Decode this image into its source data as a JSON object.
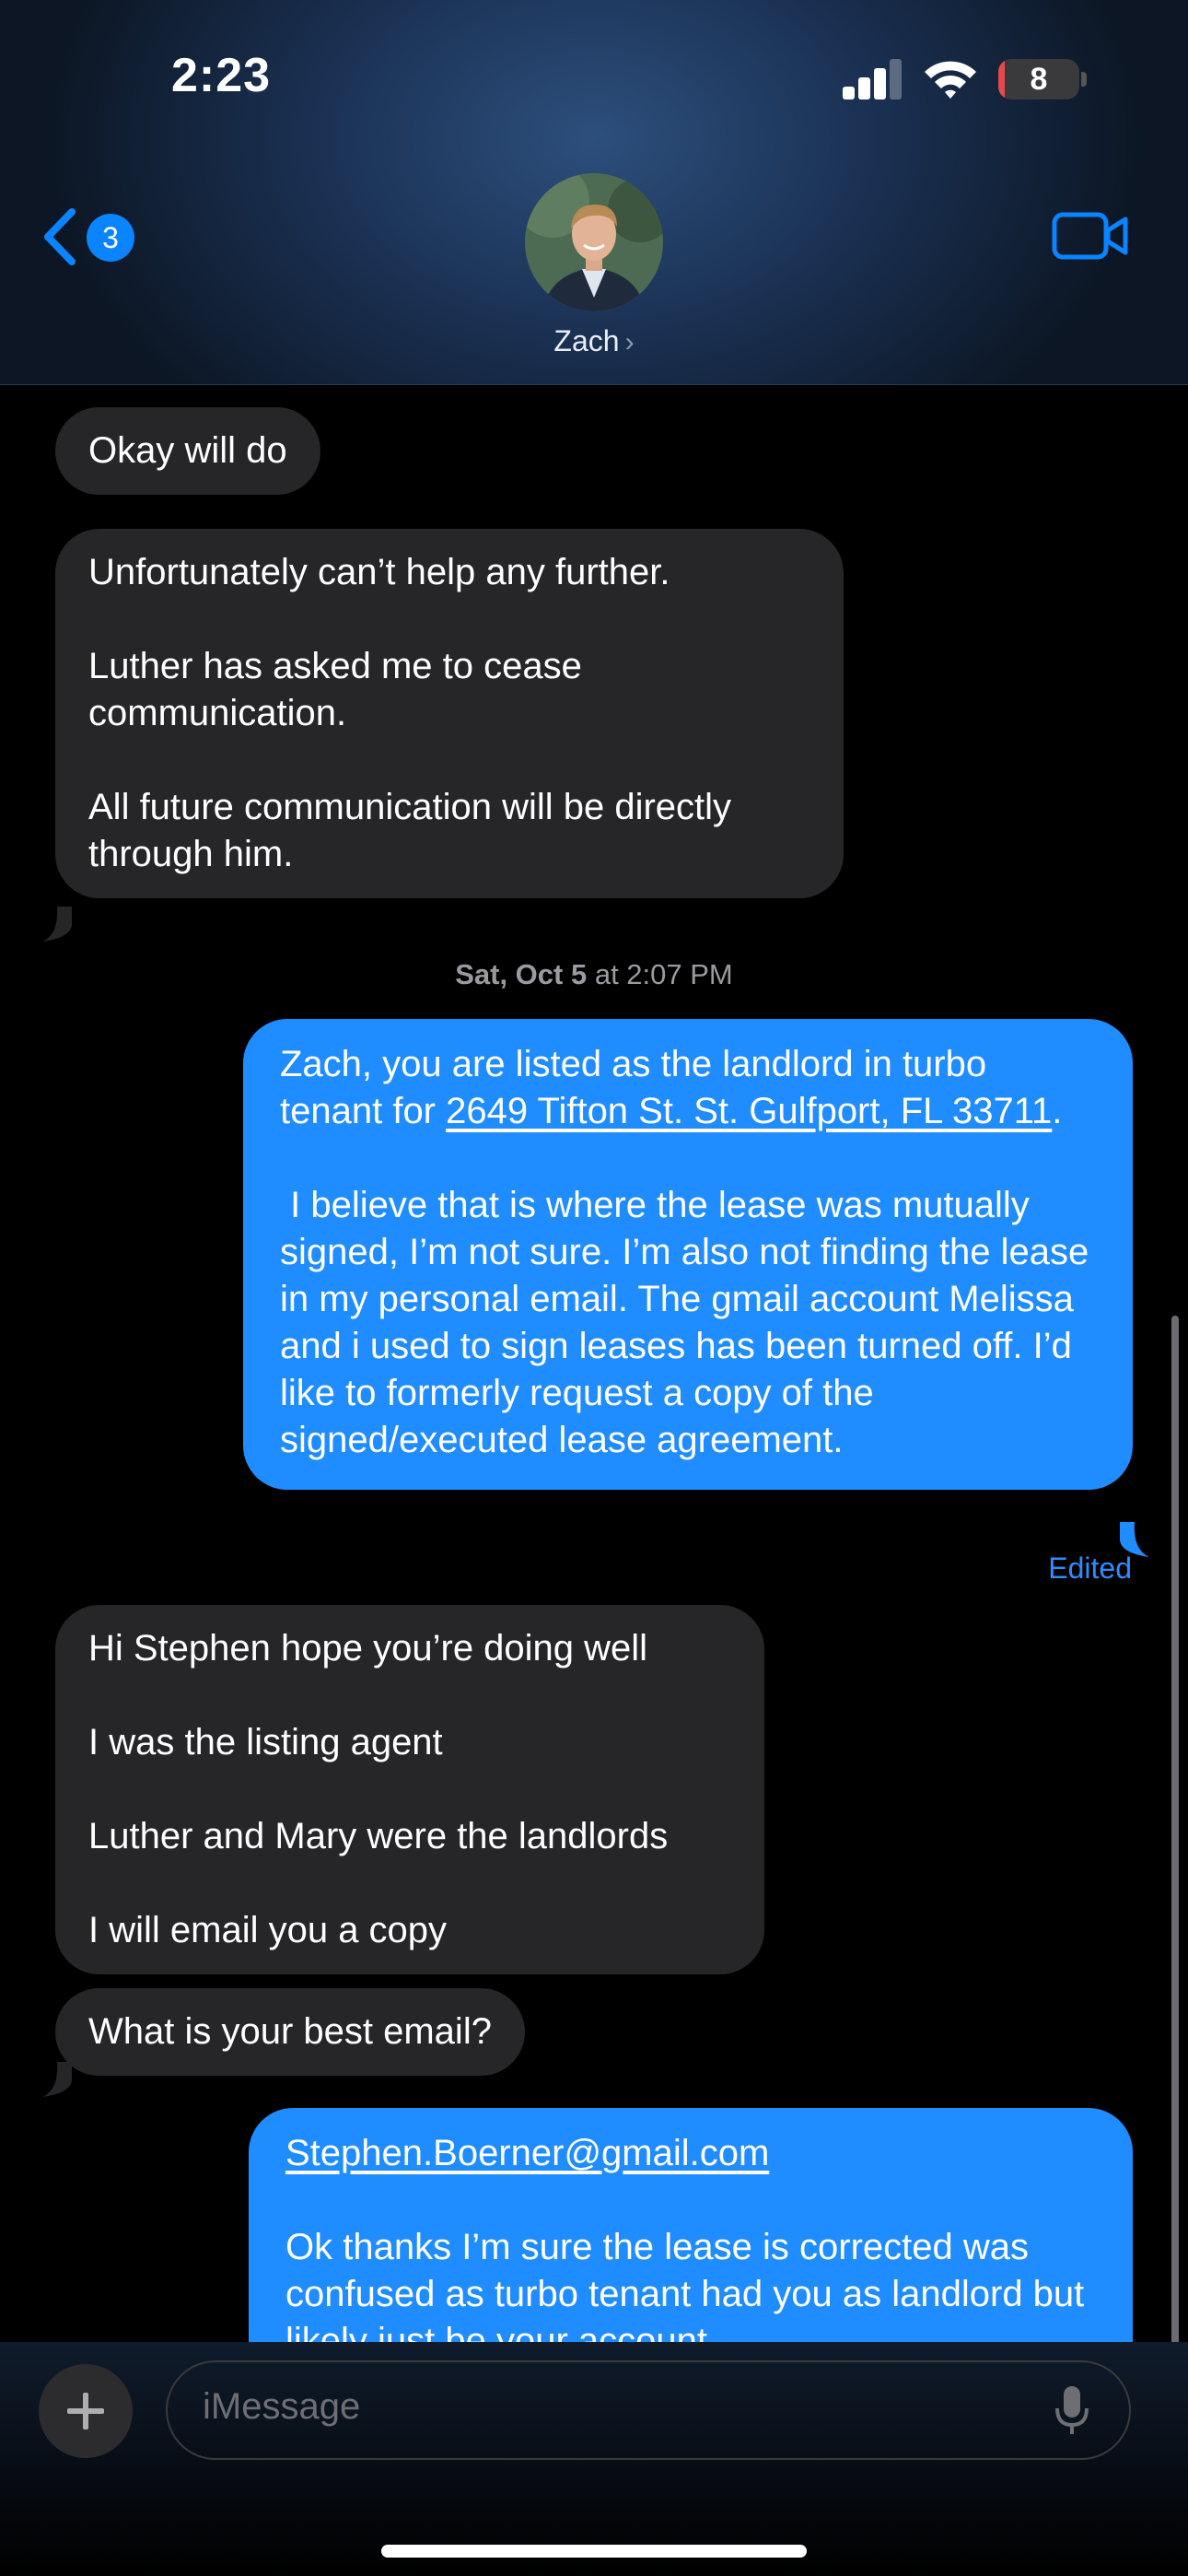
{
  "status_bar": {
    "time": "2:23",
    "battery_level": "8",
    "battery_fraction": 0.08,
    "signal_bars": 3
  },
  "header": {
    "back_unread_count": "3",
    "contact_name": "Zach",
    "contact_chevron": "›",
    "icons": [
      "back-chevron-icon",
      "video-camera-icon"
    ]
  },
  "thread": {
    "messages": [
      {
        "direction": "incoming",
        "text": "Okay will do"
      },
      {
        "direction": "incoming",
        "text": "Unfortunately can’t help any further.\n\nLuther has asked me to cease communication.\n\nAll future communication will be directly through him."
      },
      {
        "direction": "outgoing",
        "text_before_link": "Zach, you are listed as the landlord in turbo tenant for ",
        "link": "2649 Tifton St. St. Gulfport, FL 33711",
        "text_after_link": ".\n\n I believe that is where the lease was mutually signed, I’m not sure. I’m also not finding the lease in my personal email. The gmail account Melissa and i used to sign leases has been turned off. I’d like to formerly request a copy of the signed/executed lease agreement.",
        "status": "Edited"
      },
      {
        "direction": "incoming",
        "text": "Hi Stephen hope you’re doing well\n\nI was the listing agent\n\nLuther and Mary were the landlords\n\nI will email you a copy"
      },
      {
        "direction": "incoming",
        "text": "What is your best email?"
      },
      {
        "direction": "outgoing",
        "link": "Stephen.Boerner@gmail.com",
        "text_after_link": "\n\nOk thanks I’m sure the lease is corrected was confused as turbo tenant had you as landlord but likely just be your account"
      }
    ],
    "timestamp_day": "Sat, Oct 5",
    "timestamp_time": "at 2:07 PM"
  },
  "composer": {
    "placeholder": "iMessage"
  },
  "colors": {
    "outgoing_bubble": "#1f8cff",
    "incoming_bubble": "#262628",
    "accent": "#0a84ff",
    "battery_low": "#e5484d"
  }
}
